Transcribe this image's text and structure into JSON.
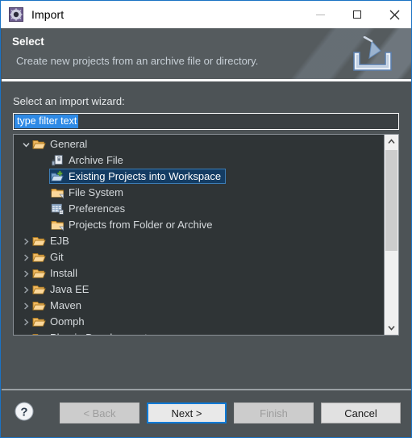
{
  "window": {
    "title": "Import",
    "icon": "eclipse-import-icon",
    "controls": {
      "minimize": "minimize-icon",
      "maximize": "maximize-icon",
      "close": "close-icon"
    }
  },
  "banner": {
    "title": "Select",
    "subtitle": "Create new projects from an archive file or directory.",
    "icon": "import-tray-icon"
  },
  "form": {
    "tree_label": "Select an import wizard:",
    "filter": {
      "value": "type filter text",
      "placeholder": "type filter text",
      "selected": true
    }
  },
  "tree": {
    "items": [
      {
        "label": "General",
        "level": 0,
        "state": "expanded",
        "icon": "folder-open-icon",
        "selected": false
      },
      {
        "label": "Archive File",
        "level": 1,
        "state": "leaf",
        "icon": "archive-file-icon",
        "selected": false
      },
      {
        "label": "Existing Projects into Workspace",
        "level": 1,
        "state": "leaf",
        "icon": "import-projects-icon",
        "selected": true
      },
      {
        "label": "File System",
        "level": 1,
        "state": "leaf",
        "icon": "folder-icon",
        "selected": false
      },
      {
        "label": "Preferences",
        "level": 1,
        "state": "leaf",
        "icon": "preferences-icon",
        "selected": false
      },
      {
        "label": "Projects from Folder or Archive",
        "level": 1,
        "state": "leaf",
        "icon": "folder-icon",
        "selected": false
      },
      {
        "label": "EJB",
        "level": 0,
        "state": "collapsed",
        "icon": "folder-open-icon",
        "selected": false
      },
      {
        "label": "Git",
        "level": 0,
        "state": "collapsed",
        "icon": "folder-open-icon",
        "selected": false
      },
      {
        "label": "Install",
        "level": 0,
        "state": "collapsed",
        "icon": "folder-open-icon",
        "selected": false
      },
      {
        "label": "Java EE",
        "level": 0,
        "state": "collapsed",
        "icon": "folder-open-icon",
        "selected": false
      },
      {
        "label": "Maven",
        "level": 0,
        "state": "collapsed",
        "icon": "folder-open-icon",
        "selected": false
      },
      {
        "label": "Oomph",
        "level": 0,
        "state": "collapsed",
        "icon": "folder-open-icon",
        "selected": false
      },
      {
        "label": "Plug-in Development",
        "level": 0,
        "state": "collapsed",
        "icon": "folder-open-icon",
        "selected": false
      }
    ],
    "scrollbar": {
      "up_arrow": "chevron-up-icon",
      "down_arrow": "chevron-down-icon"
    }
  },
  "footer": {
    "help": "help-icon",
    "buttons": [
      {
        "label": "< Back",
        "state": "disabled"
      },
      {
        "label": "Next >",
        "state": "focused"
      },
      {
        "label": "Finish",
        "state": "disabled"
      },
      {
        "label": "Cancel",
        "state": "enabled"
      }
    ]
  },
  "colors": {
    "dialog_bg": "#4d5356",
    "banner_bg": "#555b5e",
    "tree_bg": "#2f3436",
    "selection_fill": "#143c63",
    "selection_border": "#3d7cb4",
    "filter_selection": "#2e8ae6",
    "window_border": "#1a72c4",
    "focus_blue": "#0b7ad6"
  }
}
